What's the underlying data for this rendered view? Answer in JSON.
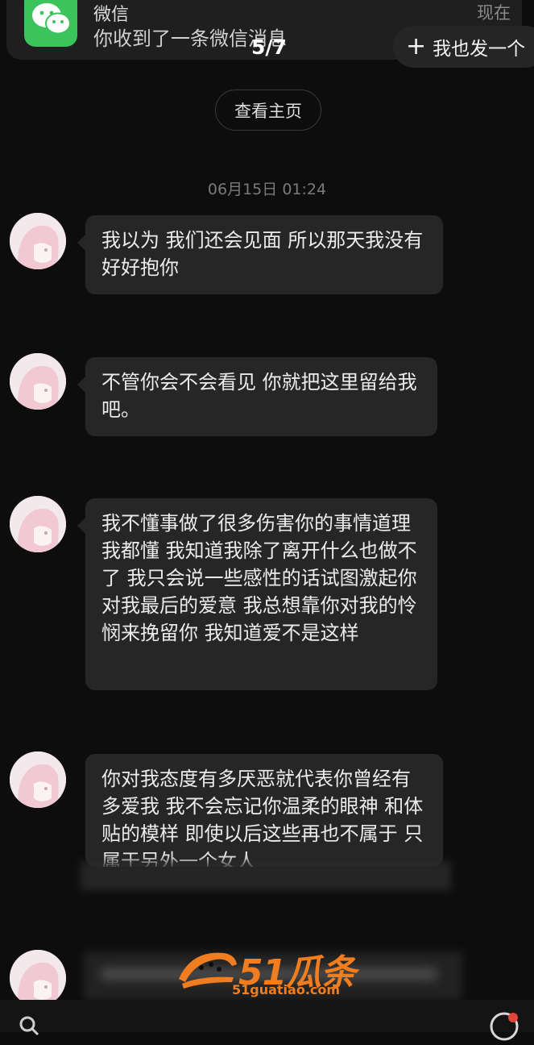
{
  "notification": {
    "app_name": "微信",
    "message": "你收到了一条微信消息",
    "time": "现在"
  },
  "viewer": {
    "page_counter": "5/7",
    "share_button": "我也发一个"
  },
  "profile": {
    "view_profile_button": "查看主页"
  },
  "chat": {
    "timestamp": "06月15日 01:24",
    "messages": [
      {
        "text": "我以为 我们还会见面 所以那天我没有好好抱你"
      },
      {
        "text": "不管你会不会看见 你就把这里留给我吧。"
      },
      {
        "text": "我不懂事做了很多伤害你的事情道理我都懂 我知道我除了离开什么也做不了 我只会说一些感性的话试图激起你对我最后的爱意 我总想靠你对我的怜悯来挽留你 我知道爱不是这样"
      },
      {
        "text": "你对我态度有多厌恶就代表你曾经有多爱我 我不会忘记你温柔的眼神 和体贴的模样 即使以后这些再也不属于 只属于另外一个女人"
      }
    ]
  },
  "watermark": {
    "brand": "51瓜条",
    "url": "51guatiao.com",
    "color": "#f07d1f"
  },
  "icons": {
    "app": "wechat-icon",
    "share": "plus-icon",
    "bottom_left": "search-icon",
    "bottom_right": "like-icon"
  }
}
